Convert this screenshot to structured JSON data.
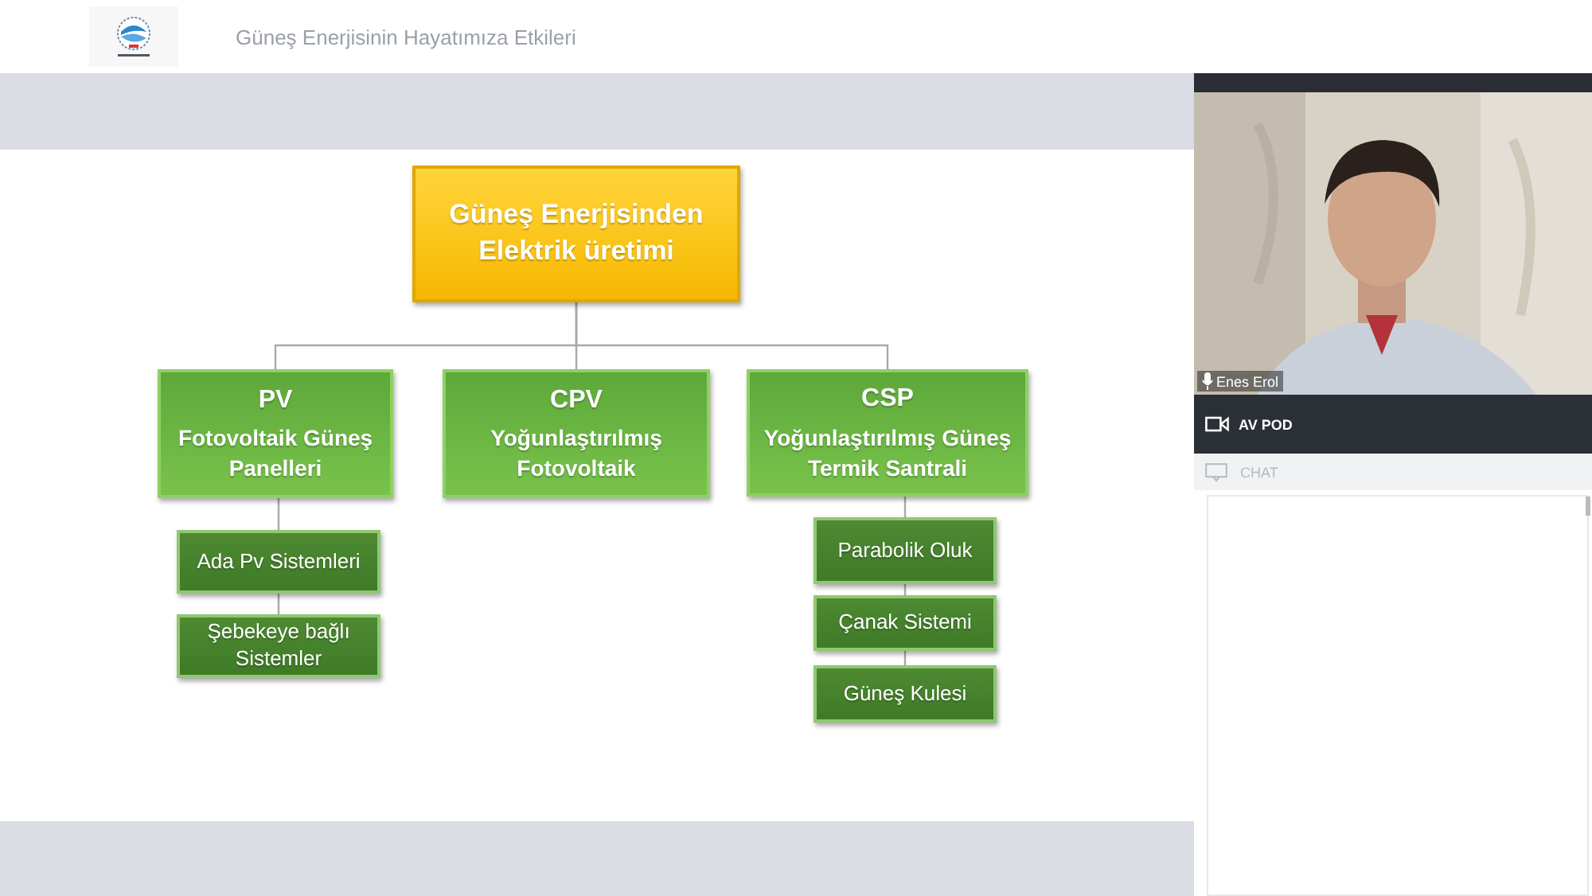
{
  "header": {
    "title": "Güneş Enerjisinin Hayatımıza Etkileri"
  },
  "diagram": {
    "label": "Güneş Enerjisinden Elektrik üretimi",
    "children": [
      {
        "title": "PV",
        "label": "Fotovoltaik Güneş Panelleri",
        "children": [
          {
            "label": "Ada Pv Sistemleri"
          },
          {
            "label": "Şebekeye bağlı Sistemler"
          }
        ]
      },
      {
        "title": "CPV",
        "label": "Yoğunlaştırılmış Fotovoltaik"
      },
      {
        "title": "CSP",
        "label": "Yoğunlaştırılmış Güneş Termik Santrali",
        "children": [
          {
            "label": "Parabolik Oluk"
          },
          {
            "label": "Çanak Sistemi"
          },
          {
            "label": "Güneş Kulesi"
          }
        ]
      }
    ]
  },
  "video": {
    "participant": "Enes Erol"
  },
  "av_pod": {
    "title": "AV POD"
  },
  "chat": {
    "title": "CHAT"
  }
}
